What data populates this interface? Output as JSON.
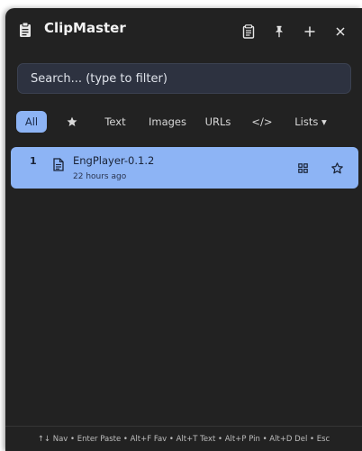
{
  "app": {
    "title": "ClipMaster",
    "icon": "clipboard-icon"
  },
  "titlebar": {
    "buttons": [
      {
        "name": "notes-icon"
      },
      {
        "name": "pin-icon"
      },
      {
        "name": "plus-icon"
      },
      {
        "name": "close-icon"
      }
    ]
  },
  "search": {
    "placeholder": "Search... (type to filter)",
    "value": ""
  },
  "filters": {
    "all": "All",
    "favorites_icon": "star-icon",
    "text": "Text",
    "images": "Images",
    "urls": "URLs",
    "code": "</>",
    "lists": "Lists ▾",
    "active": "All"
  },
  "items": [
    {
      "index": "1",
      "type_icon": "document-icon",
      "title": "EngPlayer-0.1.2",
      "time": "22 hours ago",
      "selected": true
    }
  ],
  "footer": {
    "hint": "↑↓ Nav • Enter Paste • Alt+F Fav • Alt+T Text • Alt+P Pin • Alt+D Del • Esc"
  },
  "colors": {
    "window_bg": "#222222",
    "accent": "#8db4f5",
    "search_bg": "#2d3240"
  }
}
